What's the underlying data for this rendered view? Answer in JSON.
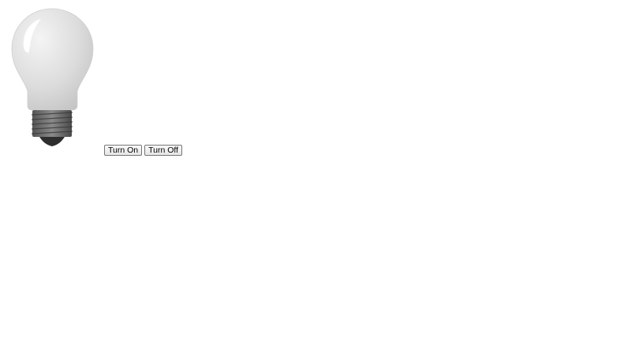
{
  "bulb": {
    "icon": "lightbulb-icon",
    "state": "off"
  },
  "controls": {
    "turn_on_label": "Turn On",
    "turn_off_label": "Turn Off"
  }
}
